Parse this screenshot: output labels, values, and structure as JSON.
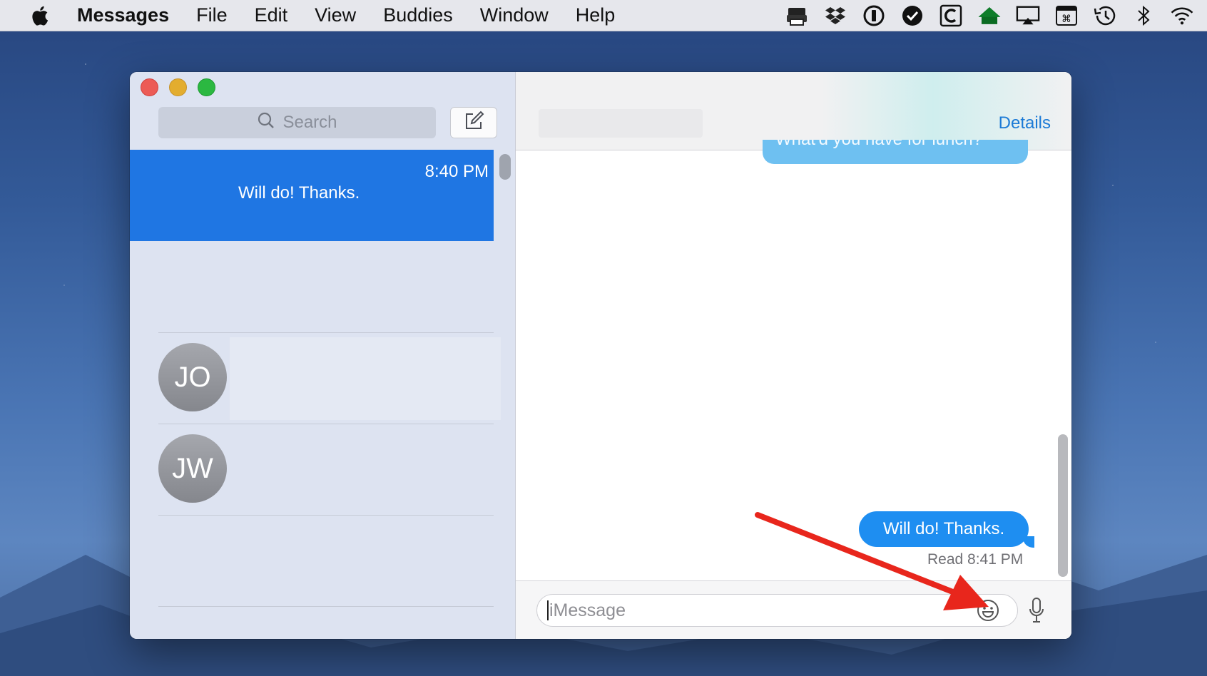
{
  "menubar": {
    "apple_icon": "apple-logo-icon",
    "app_name": "Messages",
    "items": [
      "File",
      "Edit",
      "View",
      "Buddies",
      "Window",
      "Help"
    ],
    "status_icons": [
      "printer-icon",
      "dropbox-icon",
      "1password-icon",
      "checkmark-icon",
      "c-app-icon",
      "house-icon",
      "airplay-icon",
      "keyboard-viewer-icon",
      "time-machine-icon",
      "bluetooth-icon",
      "wifi-icon"
    ]
  },
  "sidebar": {
    "search_placeholder": "Search",
    "compose_icon": "compose-icon",
    "conversations": [
      {
        "time": "8:40 PM",
        "snippet": "Will do! Thanks.",
        "selected": true
      },
      {
        "initials": "JO"
      },
      {
        "initials": "JW"
      }
    ]
  },
  "chat": {
    "details_label": "Details",
    "partial_message": "What'd you have for lunch?",
    "last_message": "Will do! Thanks.",
    "read_receipt": "Read 8:41 PM",
    "input_placeholder": "iMessage",
    "emoji_icon": "smiley-face-icon",
    "mic_icon": "microphone-icon"
  },
  "colors": {
    "selection": "#1f76e3",
    "bubble": "#1e8ef1",
    "link": "#1b7ad6",
    "arrow": "#e8261c"
  }
}
